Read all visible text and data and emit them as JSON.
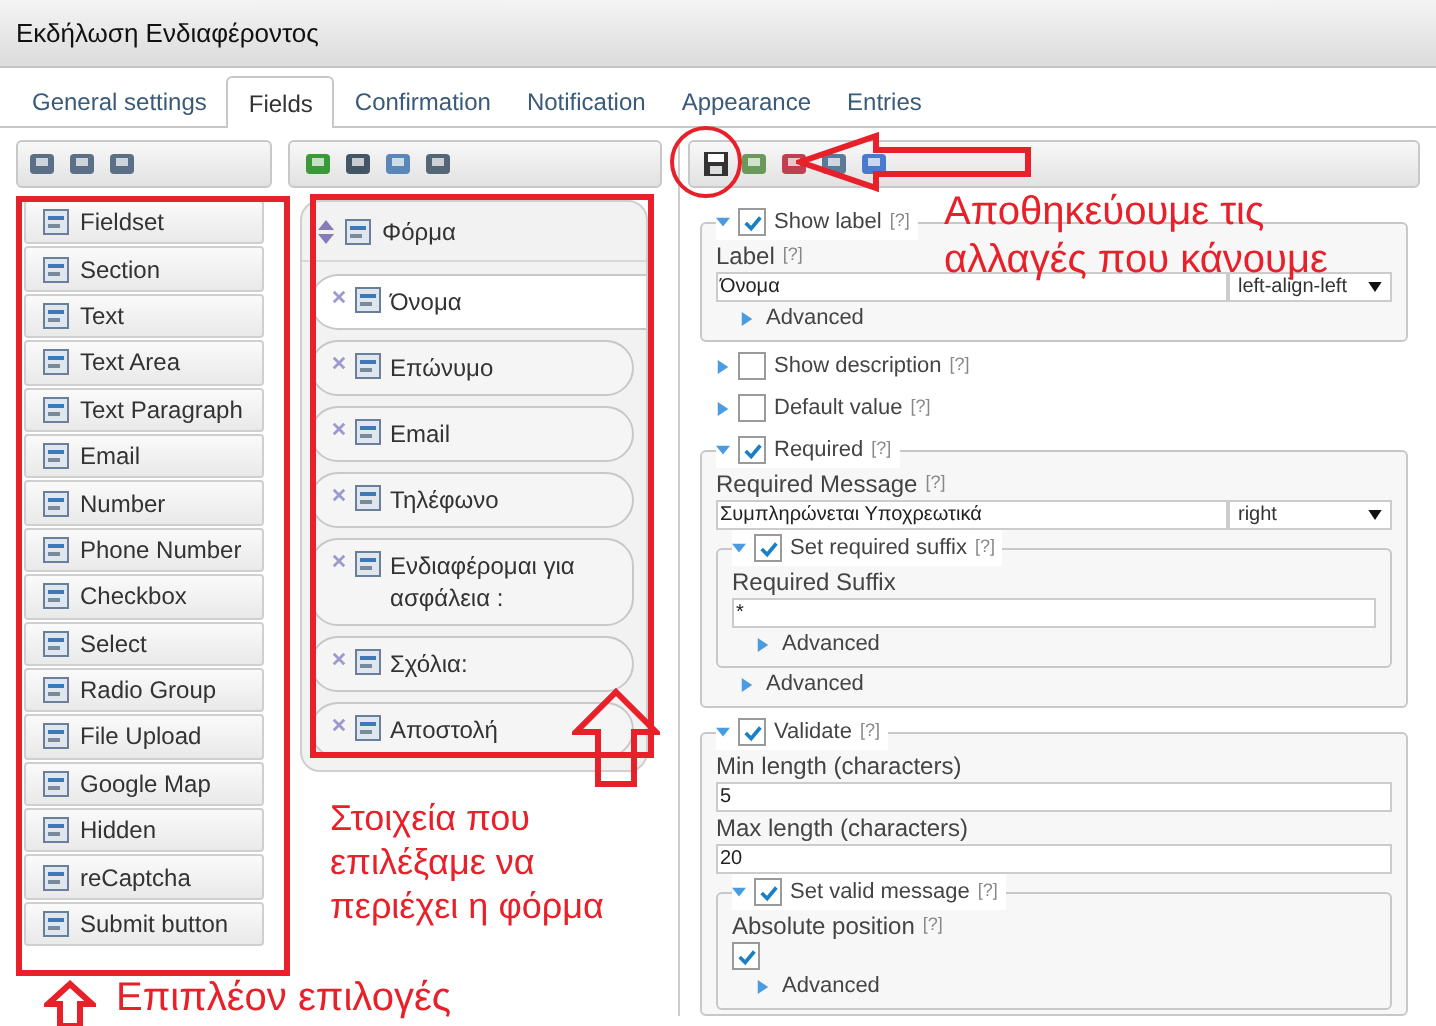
{
  "window": {
    "title": "Εκδήλωση Ενδιαφέροντος"
  },
  "tabs": [
    {
      "label": "General settings",
      "selected": false
    },
    {
      "label": "Fields",
      "selected": true
    },
    {
      "label": "Confirmation",
      "selected": false
    },
    {
      "label": "Notification",
      "selected": false
    },
    {
      "label": "Appearance",
      "selected": false
    },
    {
      "label": "Entries",
      "selected": false
    }
  ],
  "palette": {
    "items": [
      {
        "label": "Fieldset"
      },
      {
        "label": "Section"
      },
      {
        "label": "Text"
      },
      {
        "label": "Text Area"
      },
      {
        "label": "Text Paragraph"
      },
      {
        "label": "Email"
      },
      {
        "label": "Number"
      },
      {
        "label": "Phone Number"
      },
      {
        "label": "Checkbox"
      },
      {
        "label": "Select"
      },
      {
        "label": "Radio Group"
      },
      {
        "label": "File Upload"
      },
      {
        "label": "Google Map"
      },
      {
        "label": "Hidden"
      },
      {
        "label": "reCaptcha"
      },
      {
        "label": "Submit button"
      }
    ]
  },
  "form": {
    "title": "Φόρμα",
    "fields": [
      {
        "label": "Όνομα",
        "selected": true
      },
      {
        "label": "Επώνυμο",
        "selected": false
      },
      {
        "label": "Email",
        "selected": false
      },
      {
        "label": "Τηλέφωνο",
        "selected": false
      },
      {
        "label": "Ενδιαφέρομαι για ασφάλεια :",
        "selected": false
      },
      {
        "label": "Σχόλια:",
        "selected": false
      },
      {
        "label": "Αποστολή",
        "selected": false
      }
    ]
  },
  "properties": [
    {
      "kind": "group",
      "label": "Show label",
      "help": "[?]",
      "checked": true,
      "expanded": true,
      "children": [
        {
          "kind": "field",
          "label": "Label",
          "help": "[?]",
          "value": "Όνομα",
          "select": "left-align-left"
        },
        {
          "kind": "advanced",
          "label": "Advanced"
        }
      ]
    },
    {
      "kind": "group",
      "label": "Show description",
      "help": "[?]",
      "checked": false,
      "expanded": false
    },
    {
      "kind": "group",
      "label": "Default value",
      "help": "[?]",
      "checked": false,
      "expanded": false
    },
    {
      "kind": "group",
      "label": "Required",
      "help": "[?]",
      "checked": true,
      "expanded": true,
      "children": [
        {
          "kind": "field",
          "label": "Required Message",
          "help": "[?]",
          "value": "Συμπληρώνεται Υποχρεωτικά",
          "select": "right"
        },
        {
          "kind": "group",
          "label": "Set required suffix",
          "help": "[?]",
          "checked": true,
          "expanded": true,
          "children": [
            {
              "kind": "field",
              "label": "Required Suffix",
              "value": "*"
            },
            {
              "kind": "advanced",
              "label": "Advanced"
            }
          ]
        },
        {
          "kind": "advanced",
          "label": "Advanced"
        }
      ]
    },
    {
      "kind": "group",
      "label": "Validate",
      "help": "[?]",
      "checked": true,
      "expanded": true,
      "children": [
        {
          "kind": "field",
          "label": "Min length (characters)",
          "value": "5"
        },
        {
          "kind": "field",
          "label": "Max length (characters)",
          "value": "20"
        },
        {
          "kind": "group",
          "label": "Set valid message",
          "help": "[?]",
          "checked": true,
          "expanded": true,
          "children": [
            {
              "kind": "check",
              "label": "Absolute position",
              "help": "[?]",
              "checked": true
            },
            {
              "kind": "advanced",
              "label": "Advanced"
            }
          ]
        }
      ]
    }
  ],
  "annotations": [
    {
      "kind": "save",
      "text": "Αποθηκεύουμε τις αλλαγές που κάνουμε"
    },
    {
      "kind": "form",
      "text": "Στοιχεία που επιλέξαμε να περιέχει η φόρμα"
    },
    {
      "kind": "palette",
      "text": "Επιπλέον επιλογές"
    }
  ]
}
